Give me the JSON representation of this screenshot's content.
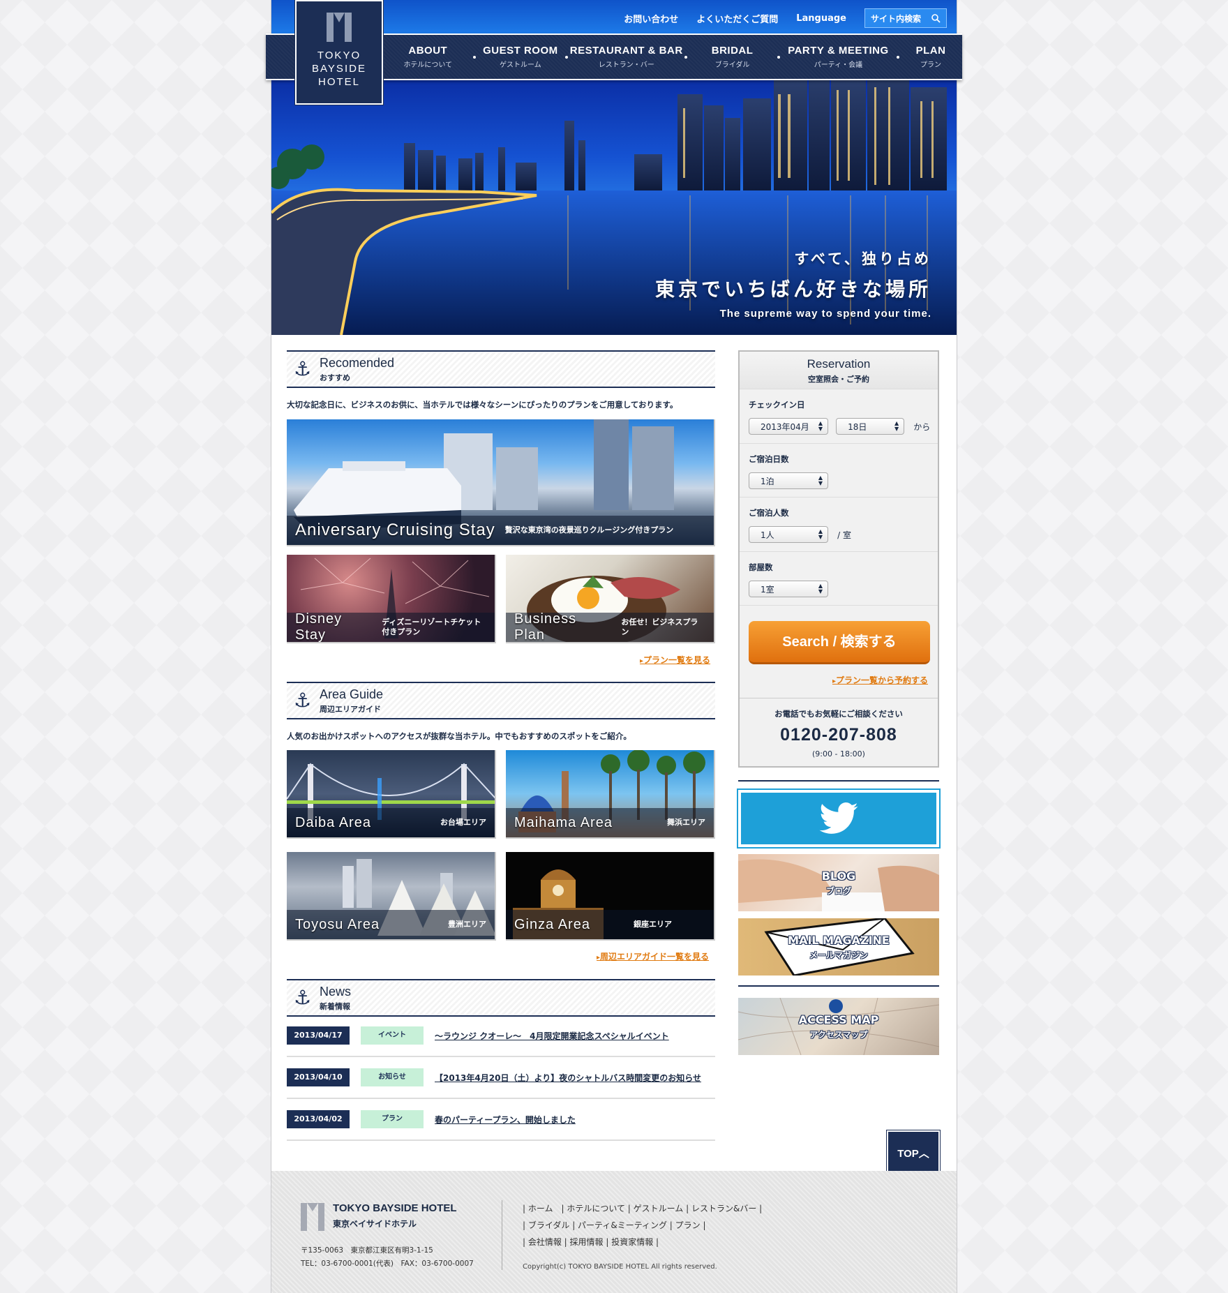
{
  "utility": {
    "contact": "お問い合わせ",
    "faq": "よくいただくご質問",
    "language": "Language",
    "search_placeholder": "サイト内検索"
  },
  "logo": {
    "line1": "TOKYO",
    "line2": "BAYSIDE",
    "line3": "HOTEL"
  },
  "nav": [
    {
      "en": "ABOUT",
      "ja": "ホテルについて"
    },
    {
      "en": "GUEST ROOM",
      "ja": "ゲストルーム"
    },
    {
      "en": "RESTAURANT & BAR",
      "ja": "レストラン・バー"
    },
    {
      "en": "BRIDAL",
      "ja": "ブライダル"
    },
    {
      "en": "PARTY & MEETING",
      "ja": "パーティ・会議"
    },
    {
      "en": "PLAN",
      "ja": "プラン"
    }
  ],
  "hero": {
    "line1": "すべて、独り占め",
    "line2": "東京でいちばん好きな場所",
    "line3": "The supreme way to spend your time."
  },
  "recommended": {
    "title_en": "Recomended",
    "title_ja": "おすすめ",
    "lead": "大切な記念日に、ビジネスのお供に、当ホテルでは様々なシーンにぴったりのプランをご用意しております。",
    "main": {
      "en": "Aniversary Cruising Stay",
      "ja": "贅沢な東京湾の夜景巡りクルージング付きプラン"
    },
    "cards": [
      {
        "en": "Disney Stay",
        "ja": "ディズニーリゾートチケット付きプラン"
      },
      {
        "en": "Business Plan",
        "ja": "お任せ！ビジネスプラン"
      }
    ],
    "more": "プラン一覧を見る"
  },
  "area": {
    "title_en": "Area Guide",
    "title_ja": "周辺エリアガイド",
    "lead": "人気のお出かけスポットへのアクセスが抜群な当ホテル。中でもおすすめのスポットをご紹介。",
    "cards": [
      {
        "en": "Daiba Area",
        "ja": "お台場エリア"
      },
      {
        "en": "Maihama Area",
        "ja": "舞浜エリア"
      },
      {
        "en": "Toyosu Area",
        "ja": "豊洲エリア"
      },
      {
        "en": "Ginza Area",
        "ja": "銀座エリア"
      }
    ],
    "more": "周辺エリアガイド一覧を見る"
  },
  "news": {
    "title_en": "News",
    "title_ja": "新着情報",
    "items": [
      {
        "date": "2013/04/17",
        "cat": "イベント",
        "title": "～ラウンジ クオーレ～　4月限定開業記念スペシャルイベント"
      },
      {
        "date": "2013/04/10",
        "cat": "お知らせ",
        "title": "【2013年4月20日（土）より】夜のシャトルバス時間変更のお知らせ"
      },
      {
        "date": "2013/04/02",
        "cat": "プラン",
        "title": "春のパーティープラン、開始しました"
      }
    ]
  },
  "reservation": {
    "title_en": "Reservation",
    "title_ja": "空室照会・ご予約",
    "checkin_label": "チェックイン日",
    "month": "2013年04月",
    "day": "18日",
    "from": "から",
    "nights_label": "ご宿泊日数",
    "nights": "1泊",
    "people_label": "ご宿泊人数",
    "people": "1人",
    "per_room": "/ 室",
    "rooms_label": "部屋数",
    "rooms": "1室",
    "search": "Search / 検索する",
    "plan_link": "プラン一覧から予約する",
    "tel_note": "お電話でもお気軽にご相談ください",
    "tel": "0120-207-808",
    "hours": "(9:00 - 18:00)"
  },
  "banners": {
    "blog_en": "BLOG",
    "blog_ja": "ブログ",
    "mail_en": "MAIL MAGAZINE",
    "mail_ja": "メールマガジン",
    "access_en": "ACCESS MAP",
    "access_ja": "アクセスマップ"
  },
  "top_button": "TOP",
  "footer": {
    "name": "TOKYO BAYSIDE HOTEL",
    "name_ja": "東京ベイサイドホテル",
    "postal": "〒135-0063　東京都江東区有明3-1-15",
    "telfax": "TEL：03-6700-0001(代表)　FAX：03-6700-0007",
    "links1": "| ホーム　| ホテルについて | ゲストルーム | レストラン&バー |",
    "links2": "| ブライダル | パーティ&ミーティング | プラン |",
    "links3": "| 会社情報 | 採用情報 | 投資家情報 |",
    "copyright": "Copyright(c) TOKYO BAYSIDE HOTEL All rights reserved."
  },
  "colors": {
    "navy": "#1c2e55",
    "orange": "#e07a10",
    "twitter": "#1ea0d8",
    "accent_green": "#c7f0d8"
  },
  "icons": [
    "anchor-icon",
    "search-icon",
    "twitter-bird-icon",
    "chevron-up-icon"
  ]
}
